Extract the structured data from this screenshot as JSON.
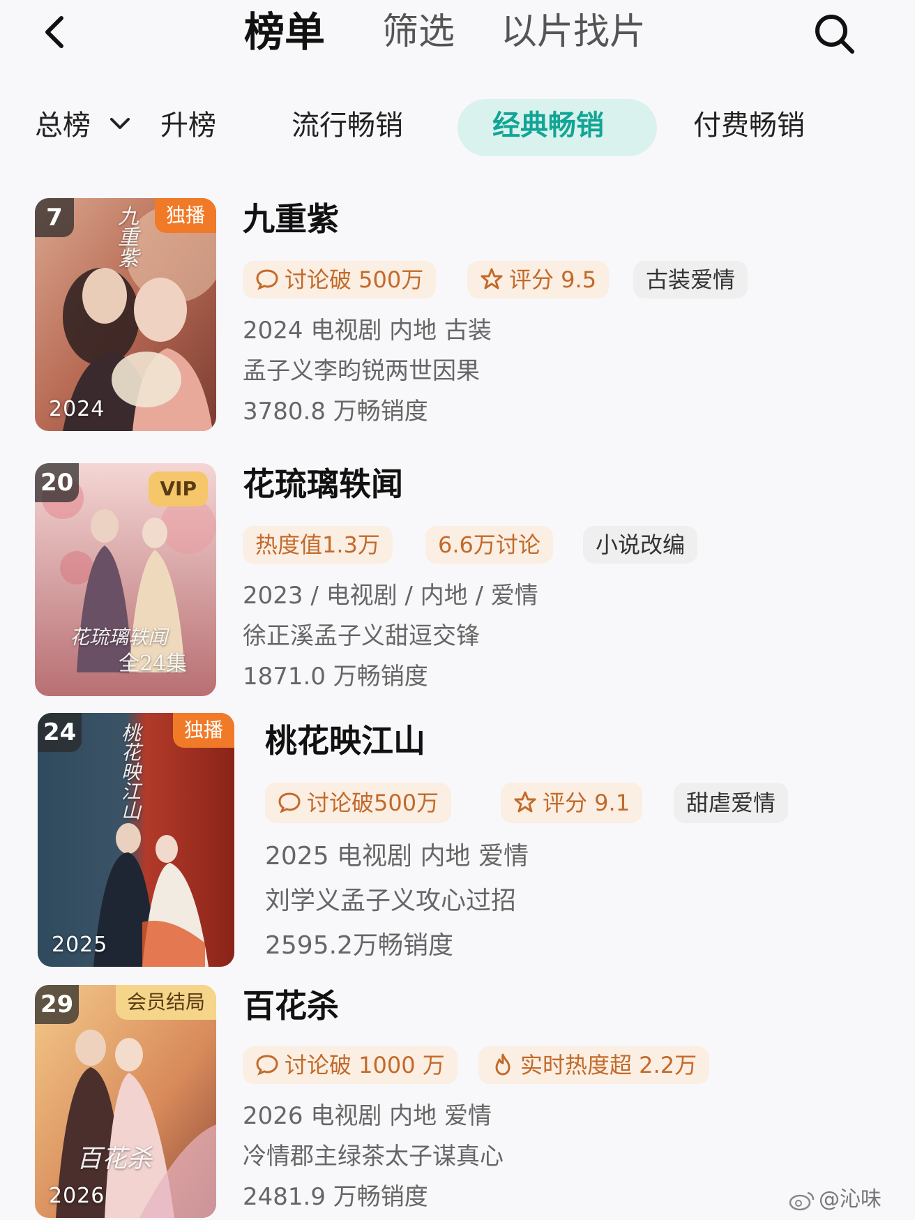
{
  "header": {
    "tabs": [
      "榜单",
      "筛选",
      "以片找片"
    ]
  },
  "subnav": {
    "items": [
      "总榜",
      "升榜",
      "流行畅销",
      "经典畅销",
      "付费畅销"
    ],
    "active": "经典畅销"
  },
  "items": [
    {
      "rank": "7",
      "badge": "独播",
      "year": "2024",
      "poster_text": "九重紫",
      "title": "九重紫",
      "tags": [
        {
          "icon": "comment-icon",
          "text": "讨论破 500万"
        },
        {
          "icon": "star-icon",
          "text": "评分 9.5"
        },
        {
          "icon": "",
          "text": "古装爱情"
        }
      ],
      "meta_line": "2024 电视剧 内地 古装",
      "desc": "孟子义李昀锐两世因果",
      "sales": "3780.8 万畅销度"
    },
    {
      "rank": "20",
      "badge": "VIP",
      "year": "",
      "poster_text": "花琉璃轶闻",
      "poster_episodes": "全24集",
      "title": "花琉璃轶闻",
      "tags": [
        {
          "icon": "",
          "text": "热度值1.3万"
        },
        {
          "icon": "",
          "text": "6.6万讨论"
        },
        {
          "icon": "",
          "text": "小说改编"
        }
      ],
      "meta_line": "2023 / 电视剧 / 内地 / 爱情",
      "desc": "徐正溪孟子义甜逗交锋",
      "sales": "1871.0 万畅销度"
    },
    {
      "rank": "24",
      "badge": "独播",
      "year": "2025",
      "poster_text": "桃花映江山",
      "title": "桃花映江山",
      "tags": [
        {
          "icon": "comment-icon",
          "text": "讨论破500万"
        },
        {
          "icon": "star-icon",
          "text": "评分 9.1"
        },
        {
          "icon": "",
          "text": "甜虐爱情"
        }
      ],
      "meta_line": "2025 电视剧 内地 爱情",
      "desc": "刘学义孟子义攻心过招",
      "sales": "2595.2万畅销度"
    },
    {
      "rank": "29",
      "badge": "会员结局",
      "year": "2026",
      "poster_text": "百花杀",
      "title": "百花杀",
      "tags": [
        {
          "icon": "comment-icon",
          "text": "讨论破 1000 万"
        },
        {
          "icon": "flame-icon",
          "text": "实时热度超 2.2万"
        }
      ],
      "meta_line": "2026 电视剧 内地 爱情",
      "desc": "冷情郡主绿茶太子谋真心",
      "sales": "2481.9 万畅销度"
    }
  ],
  "watermark": "@沁味",
  "colors": {
    "accent": "#12a595",
    "accent_pill": "#d9f2ee",
    "tag_warm_bg": "#fbeee3",
    "tag_warm_text": "#c26a2a",
    "badge_orange": "#f07a28",
    "badge_vip": "#f5c76a"
  }
}
